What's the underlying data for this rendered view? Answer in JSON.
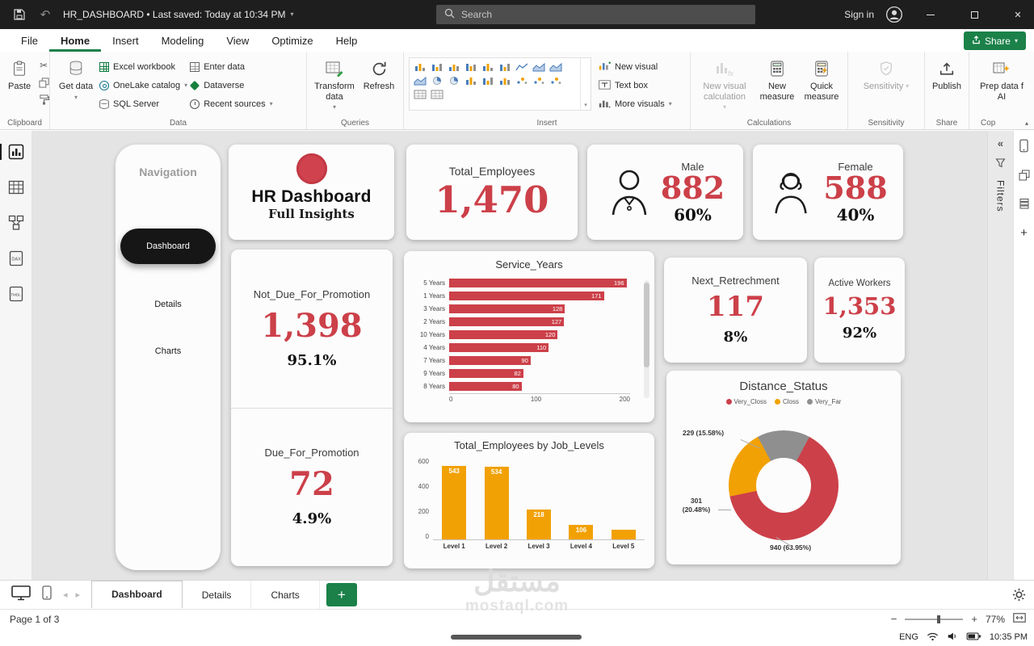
{
  "titlebar": {
    "save_state_title": "HR_DASHBOARD  •  Last saved: Today at 10:34 PM",
    "search_placeholder": "Search",
    "sign_in_label": "Sign in"
  },
  "menubar": {
    "items": [
      "File",
      "Home",
      "Insert",
      "Modeling",
      "View",
      "Optimize",
      "Help"
    ],
    "active": "Home",
    "share_label": "Share"
  },
  "ribbon": {
    "clipboard": {
      "label": "Clipboard",
      "paste_label": "Paste"
    },
    "data": {
      "label": "Data",
      "get_data_label": "Get data",
      "col1": [
        {
          "label": "Excel workbook",
          "icon": "excel-icon"
        },
        {
          "label": "OneLake catalog",
          "icon": "onelake-icon",
          "caret": true
        },
        {
          "label": "SQL Server",
          "icon": "sql-server-icon"
        }
      ],
      "col2": [
        {
          "label": "Enter data",
          "icon": "enter-data-icon"
        },
        {
          "label": "Dataverse",
          "icon": "dataverse-icon"
        },
        {
          "label": "Recent sources",
          "icon": "recent-sources-icon",
          "caret": true
        }
      ]
    },
    "queries": {
      "label": "Queries",
      "transform_label": "Transform data",
      "refresh_label": "Refresh"
    },
    "insert": {
      "label": "Insert",
      "gallery": [
        "stacked-bar",
        "clustered-bar",
        "stacked-column",
        "clustered-column",
        "full-stacked-bar",
        "full-stacked-column",
        "line",
        "area",
        "stacked-area",
        "combo",
        "pie",
        "donut",
        "ribbon-chart",
        "waterfall",
        "funnel",
        "scatter",
        "treemap",
        "map",
        "table",
        "matrix"
      ],
      "new_visual_label": "New visual",
      "text_box_label": "Text box",
      "more_visuals_label": "More visuals"
    },
    "calculations": {
      "label": "Calculations",
      "new_visual_calc_label": "New visual calculation",
      "new_measure_label": "New measure",
      "quick_measure_label": "Quick measure"
    },
    "sensitivity": {
      "label": "Sensitivity",
      "button_label": "Sensitivity"
    },
    "share": {
      "label": "Share",
      "publish_label": "Publish"
    },
    "copilot": {
      "label": "Cop",
      "line1": "Prep data f",
      "line2": "AI"
    }
  },
  "left_rail_icons": [
    "report-view",
    "table-view",
    "model-view",
    "dax-query-view",
    "tmdl-view"
  ],
  "right_rail": {
    "filters_label": "Filters"
  },
  "canvas": {
    "navigation": {
      "title": "Navigation",
      "items": [
        "Dashboard",
        "Details",
        "Charts"
      ],
      "active": "Dashboard"
    },
    "header_card": {
      "title": "HR Dashboard",
      "subtitle": "Full Insights"
    },
    "kpis": {
      "total_employees": {
        "label": "Total_Employees",
        "value": "1,470"
      },
      "male": {
        "label": "Male",
        "value": "882",
        "pct": "60%"
      },
      "female": {
        "label": "Female",
        "value": "588",
        "pct": "40%"
      },
      "not_due_for_promotion": {
        "label": "Not_Due_For_Promotion",
        "value": "1,398",
        "pct": "95.1%"
      },
      "due_for_promotion": {
        "label": "Due_For_Promotion",
        "value": "72",
        "pct": "4.9%"
      },
      "next_retrechment": {
        "label": "Next_Retrechment",
        "value": "117",
        "pct": "8%"
      },
      "active_workers": {
        "label": "Active Workers",
        "value": "1,353",
        "pct": "92%"
      }
    }
  },
  "chart_data": [
    {
      "type": "bar",
      "orientation": "horizontal",
      "title": "Service_Years",
      "categories": [
        "5 Years",
        "1 Years",
        "3 Years",
        "2 Years",
        "10 Years",
        "4 Years",
        "7 Years",
        "9 Years",
        "8 Years"
      ],
      "values": [
        196,
        171,
        128,
        127,
        120,
        110,
        90,
        82,
        80
      ],
      "xlim": [
        0,
        200
      ],
      "xticks": [
        "0",
        "100",
        "200"
      ],
      "bar_color": "#cc4049",
      "grid": false
    },
    {
      "type": "bar",
      "orientation": "vertical",
      "title": "Total_Employees by Job_Levels",
      "categories": [
        "Level 1",
        "Level 2",
        "Level 3",
        "Level 4",
        "Level 5"
      ],
      "values": [
        543,
        534,
        218,
        106,
        69
      ],
      "data_labels": [
        "543",
        "534",
        "218",
        "106",
        ""
      ],
      "ylim": [
        0,
        600
      ],
      "yticks": [
        "600",
        "400",
        "200",
        "0"
      ],
      "bar_color": "#f2a104",
      "grid": false
    },
    {
      "type": "pie",
      "subtype": "donut",
      "title": "Distance_Status",
      "legend_position": "top",
      "segments": [
        {
          "name": "Very_Closs",
          "value": 940,
          "pct": 63.95,
          "color": "#cc4049",
          "callout": "940 (63.95%)"
        },
        {
          "name": "Closs",
          "value": 301,
          "pct": 20.48,
          "color": "#f2a104",
          "callout": "301 (20.48%)"
        },
        {
          "name": "Very_Far",
          "value": 229,
          "pct": 15.58,
          "color": "#8f8f8f",
          "callout": "229 (15.58%)"
        }
      ]
    }
  ],
  "pages_bar": {
    "tabs": [
      "Dashboard",
      "Details",
      "Charts"
    ],
    "active": "Dashboard"
  },
  "statusbar": {
    "page_indicator": "Page 1 of 3",
    "zoom": "77%"
  },
  "tray": {
    "language": "ENG",
    "time": "10:35 PM"
  },
  "watermark": {
    "line1": "مستقل",
    "line2": "mostaql.com"
  },
  "colors": {
    "accent_red": "#cc4049",
    "accent_orange": "#f2a104",
    "accent_green": "#1b8149",
    "donut_gray": "#8f8f8f"
  }
}
